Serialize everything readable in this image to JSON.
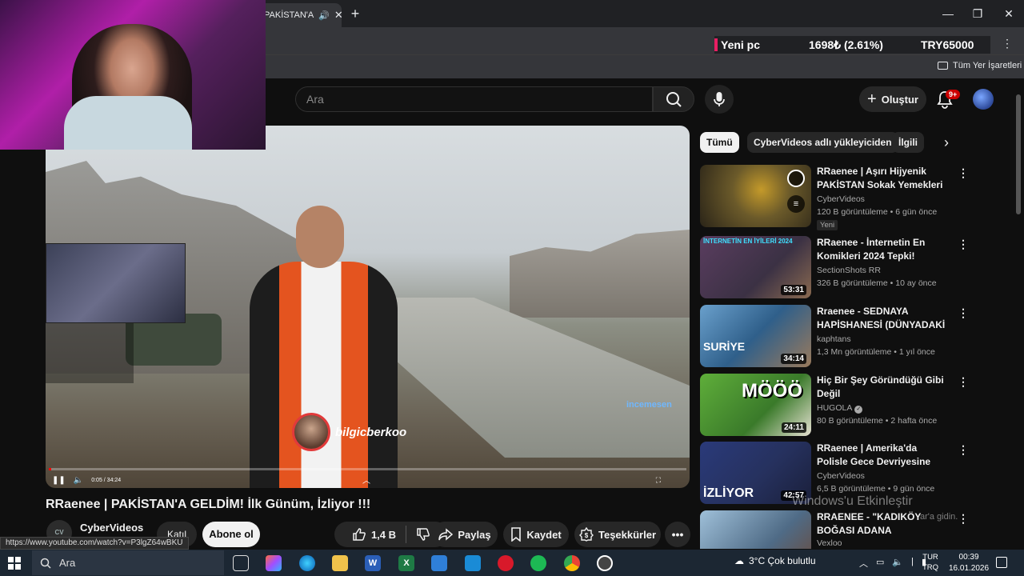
{
  "browser": {
    "tab_title": "PAKİSTAN'A",
    "ticker": {
      "symbol": "Yeni pc",
      "change": "1698₺ (2.61%)",
      "price": "TRY65000"
    },
    "bookmarks_all": "Tüm Yer İşaretleri"
  },
  "youtube": {
    "search_placeholder": "Ara",
    "create_label": "Oluştur",
    "notification_count": "9+"
  },
  "video": {
    "overlay_handle": "bilgicberkoo",
    "watermark": "incemesen",
    "time": "0:05 / 34:24",
    "title": "RRaenee | PAKİSTAN'A GELDİM! İlk Günüm, İzliyor !!!",
    "channel": "CyberVideos",
    "channel_logo": "CV",
    "join_label": "Katıl",
    "subscribe_label": "Abone ol",
    "likes": "1,4 B",
    "share_label": "Paylaş",
    "save_label": "Kaydet",
    "thanks_label": "Teşekkürler",
    "status_url": "https://www.youtube.com/watch?v=P3lgZ64wBKU"
  },
  "chips": [
    "Tümü",
    "CyberVideos adlı yükleyiciden",
    "İlgili"
  ],
  "recommendations": [
    {
      "title": "RRaenee | Aşırı Hijyenik PAKİSTAN Sokak Yemekleri ...",
      "channel": "CyberVideos",
      "meta": "120 B görüntüleme • 6 gün önce",
      "badge": "Yeni",
      "duration": "",
      "thumb_color": "#6b5a2a"
    },
    {
      "title": "RRaenee - İnternetin En Komikleri 2024 Tepki!",
      "channel": "SectionShots RR",
      "meta": "326 B görüntüleme • 10 ay önce",
      "badge": "",
      "duration": "53:31",
      "thumb_label": "İNTERNETİN EN İYİLERİ 2024",
      "thumb_color": "#3b3144"
    },
    {
      "title": "Rraenee - SEDNAYA HAPİSHANESİ (DÜNYADAKİ ...",
      "channel": "kaphtans",
      "meta": "1,3 Mn görüntüleme • 1 yıl önce",
      "badge": "",
      "duration": "34:14",
      "thumb_label": "SURİYE",
      "thumb_color": "#2f5f8a"
    },
    {
      "title": "Hiç Bir Şey Göründüğü Gibi Değil",
      "channel": "HUGOLA",
      "meta": "80 B görüntüleme • 2 hafta önce",
      "badge": "",
      "duration": "24:11",
      "thumb_label": "MÖÖÖ",
      "thumb_color": "#3a7a2a",
      "verified": "✓"
    },
    {
      "title": "RRaenee | Amerika'da Polisle Gece Devriyesine Çıktım! İzliyo...",
      "channel": "CyberVideos",
      "meta": "6,5 B görüntüleme • 9 gün önce",
      "badge": "",
      "duration": "42:57",
      "thumb_label": "İZLİYOR",
      "thumb_color": "#26315e"
    },
    {
      "title": "RRAENEE - \"KADIKÖY BOĞASI ADANA YÜREĞİR'DE BİR GÜN\" ...",
      "channel": "Vexloo",
      "meta": "",
      "badge": "",
      "duration": "",
      "thumb_color": "#4f6b86"
    }
  ],
  "windows": {
    "activate_title": "Windows'u Etkinleştir",
    "activate_sub": "ar'a gidin.",
    "search": "Ara",
    "weather": "3°C  Çok bulutlu",
    "lang_top": "TUR",
    "lang_bottom": "TRQ",
    "time": "00:39",
    "date": "16.01.2026"
  }
}
